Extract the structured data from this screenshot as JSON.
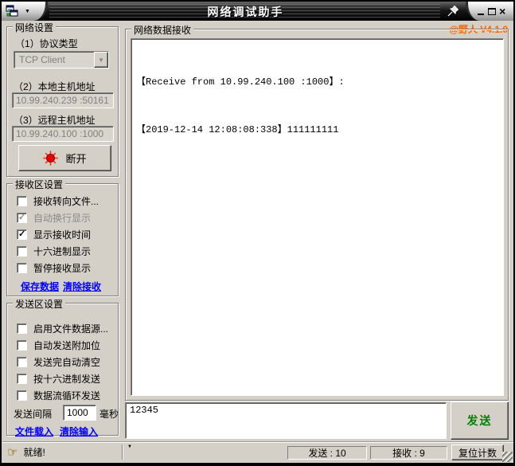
{
  "titlebar": {
    "title": "网络调试助手",
    "close_glyph": "×",
    "menu_arrow_glyph": "▼"
  },
  "network_settings": {
    "group_title": "网络设置",
    "protocol_label": "（1）协议类型",
    "protocol_value": "TCP Client",
    "local_label": "（2）本地主机地址",
    "local_value": "10.99.240.239 :50161",
    "remote_label": "（3）远程主机地址",
    "remote_value": "10.99.240.100 :1000",
    "disconnect_label": "断开"
  },
  "receive_settings": {
    "group_title": "接收区设置",
    "options": [
      {
        "label": "接收转向文件...",
        "checked": false,
        "disabled": false
      },
      {
        "label": "自动换行显示",
        "checked": true,
        "disabled": true
      },
      {
        "label": "显示接收时间",
        "checked": true,
        "disabled": false
      },
      {
        "label": "十六进制显示",
        "checked": false,
        "disabled": false
      },
      {
        "label": "暂停接收显示",
        "checked": false,
        "disabled": false
      }
    ],
    "save_link": "保存数据",
    "clear_link": "清除接收"
  },
  "send_settings": {
    "group_title": "发送区设置",
    "options": [
      {
        "label": "启用文件数据源...",
        "checked": false,
        "disabled": false
      },
      {
        "label": "自动发送附加位",
        "checked": false,
        "disabled": false
      },
      {
        "label": "发送完自动清空",
        "checked": false,
        "disabled": false
      },
      {
        "label": "按十六进制发送",
        "checked": false,
        "disabled": false
      },
      {
        "label": "数据流循环发送",
        "checked": false,
        "disabled": false
      }
    ],
    "interval_label": "发送间隔",
    "interval_value": "1000",
    "interval_unit": "毫秒",
    "load_link": "文件载入",
    "clear_link": "清除输入"
  },
  "receive_area": {
    "group_title": "网络数据接收",
    "version_label": "@野人 V4.1.0",
    "lines": [
      "【Receive from 10.99.240.100 :1000】:",
      "【2019-12-14 12:08:08:338】111111111"
    ]
  },
  "send_area": {
    "input_value": "12345",
    "send_label": "发送"
  },
  "statusbar": {
    "ready_text": "就绪!",
    "ready_hand_glyph": "☞",
    "send_count": "发送 : 10",
    "recv_count": "接收 : 9",
    "reset_label": "复位计数",
    "small_down_glyph": "▼"
  },
  "icons": {
    "combo_arrow_glyph": "▼"
  },
  "colors": {
    "window_bg": "#d4d0c8",
    "accent_orange": "#ff6600",
    "link_blue": "#0000ff",
    "send_green": "#008000",
    "led_red": "#e80000"
  }
}
